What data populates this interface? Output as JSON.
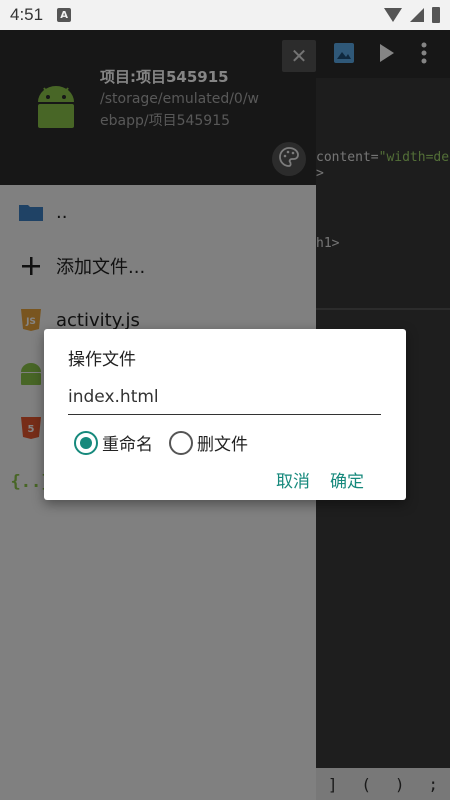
{
  "status_bar": {
    "time": "4:51",
    "notification": "A"
  },
  "editor": {
    "lines": [
      {
        "text_code": "content=",
        "text_string": "\"width=de"
      },
      {
        "text_code": ">"
      },
      {
        "text_code": "h1>"
      }
    ],
    "bottom_symbols": [
      "]",
      "(",
      ")",
      ";"
    ]
  },
  "drawer": {
    "project_title": "项目:项目545915",
    "project_path": "/storage/emulated/0/webapp/项目545915",
    "close_label": "✕",
    "files": [
      {
        "icon": "folder-icon",
        "label": ".."
      },
      {
        "icon": "plus-icon",
        "label": "添加文件..."
      },
      {
        "icon": "js-icon",
        "label": "activity.js"
      },
      {
        "icon": "android-icon",
        "label": ""
      },
      {
        "icon": "html5-icon",
        "label": ""
      },
      {
        "icon": "json-icon",
        "label": ""
      }
    ]
  },
  "dialog": {
    "title": "操作文件",
    "input_value": "index.html",
    "options": [
      {
        "label": "重命名",
        "checked": true
      },
      {
        "label": "删文件",
        "checked": false
      }
    ],
    "cancel_label": "取消",
    "ok_label": "确定"
  },
  "colors": {
    "accent": "#16897c",
    "drawer_header": "#2c2c2c"
  }
}
